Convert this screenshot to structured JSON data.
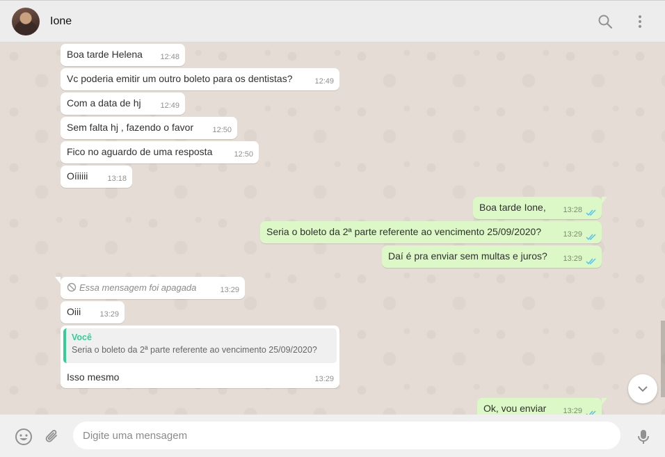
{
  "header": {
    "contact_name": "Ione"
  },
  "messages": [
    {
      "dir": "in",
      "text": "Boa tarde Helena",
      "time": "12:48"
    },
    {
      "dir": "in",
      "text": "Vc poderia emitir um outro boleto para os dentistas?",
      "time": "12:49"
    },
    {
      "dir": "in",
      "text": "Com a data de hj",
      "time": "12:49"
    },
    {
      "dir": "in",
      "text": "Sem falta hj , fazendo o favor",
      "time": "12:50"
    },
    {
      "dir": "in",
      "text": "Fico no aguardo  de uma resposta",
      "time": "12:50"
    },
    {
      "dir": "in",
      "text": "Oíiiiii",
      "time": "13:18"
    },
    {
      "dir": "out",
      "text": "Boa tarde Ione,",
      "time": "13:28",
      "status": "read"
    },
    {
      "dir": "out",
      "text": "Seria o boleto da 2ª parte referente ao vencimento 25/09/2020?",
      "time": "13:29",
      "status": "read"
    },
    {
      "dir": "out",
      "text": "Daí é pra enviar sem multas e juros?",
      "time": "13:29",
      "status": "read"
    },
    {
      "dir": "in",
      "text": "Essa mensagem foi apagada",
      "time": "13:29",
      "deleted": true
    },
    {
      "dir": "in",
      "text": "Oiii",
      "time": "13:29"
    },
    {
      "dir": "in",
      "text": "Isso mesmo",
      "time": "13:29",
      "quote": {
        "author": "Você",
        "text": "Seria o boleto da 2ª parte referente ao vencimento 25/09/2020?"
      }
    },
    {
      "dir": "out",
      "text": "Ok, vou enviar",
      "time": "13:29",
      "status": "read"
    }
  ],
  "composer": {
    "placeholder": "Digite uma mensagem"
  },
  "colors": {
    "incoming": "#ffffff",
    "outgoing": "#dcf8c6",
    "read_ticks": "#4fc3f7",
    "quote_accent": "#35cd96",
    "background": "#e5ddd5"
  },
  "icons": [
    "search-icon",
    "menu-icon",
    "ban-icon",
    "double-check-icon",
    "chevron-down-icon",
    "emoji-icon",
    "paperclip-icon",
    "microphone-icon"
  ]
}
